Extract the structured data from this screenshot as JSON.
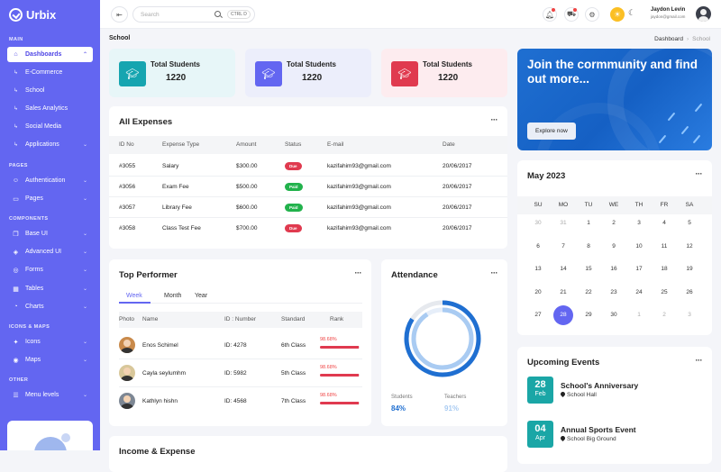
{
  "brand": {
    "name": "Urbix"
  },
  "sidebar": {
    "sections": {
      "main": "MAIN",
      "pages": "PAGES",
      "components": "COMPONENTS",
      "icons_maps": "ICONS & MAPS",
      "other": "OTHER"
    },
    "dashboards": "Dashboards",
    "ecommerce": "E-Commerce",
    "school": "School",
    "sales": "Sales Analytics",
    "social": "Social Media",
    "applications": "Applications",
    "authentication": "Authentication",
    "pages": "Pages",
    "baseui": "Base UI",
    "advancedui": "Advanced UI",
    "forms": "Forms",
    "tables": "Tables",
    "charts": "Charts",
    "icons": "Icons",
    "maps": "Maps",
    "menulevels": "Menu levels"
  },
  "header": {
    "search_placeholder": "Search",
    "shortcut": "CTRL D",
    "user_name": "Jaydon Levin",
    "user_email": "jaydon@gmail.com"
  },
  "page": {
    "title": "School",
    "crumb_parent": "Dashboard",
    "crumb_current": "School"
  },
  "stats": [
    {
      "label": "Total Students",
      "value": "1220",
      "bg": "#e7f6f8",
      "icon_bg": "#16a5b0"
    },
    {
      "label": "Total Students",
      "value": "1220",
      "bg": "#eceefb",
      "icon_bg": "#6366f1"
    },
    {
      "label": "Total Students",
      "value": "1220",
      "bg": "#fdecef",
      "icon_bg": "#e03a4f"
    }
  ],
  "expenses": {
    "title": "All Expenses",
    "columns": [
      "ID No",
      "Expense Type",
      "Amount",
      "Status",
      "E-mail",
      "Date"
    ],
    "rows": [
      {
        "id": "#3055",
        "type": "Salary",
        "amount": "$300.00",
        "status": "Due",
        "email": "kazifahim93@gmail.com",
        "date": "20/06/2017"
      },
      {
        "id": "#3056",
        "type": "Exam Fee",
        "amount": "$500.00",
        "status": "Paid",
        "email": "kazifahim93@gmail.com",
        "date": "20/06/2017"
      },
      {
        "id": "#3057",
        "type": "Library Fee",
        "amount": "$600.00",
        "status": "Paid",
        "email": "kazifahim93@gmail.com",
        "date": "20/06/2017"
      },
      {
        "id": "#3058",
        "type": "Class Test Fee",
        "amount": "$700.00",
        "status": "Due",
        "email": "kazifahim93@gmail.com",
        "date": "20/06/2017"
      }
    ],
    "status_colors": {
      "Due": "#e03a4f",
      "Paid": "#22b24c"
    }
  },
  "performer": {
    "title": "Top Performer",
    "tabs": [
      "Week",
      "Month",
      "Year"
    ],
    "columns": [
      "Photo",
      "Name",
      "ID : Number",
      "Standard",
      "Rank"
    ],
    "rows": [
      {
        "name": "Enos Schimel",
        "id": "ID: 4278",
        "standard": "6th Class",
        "rank": "98.68%",
        "rank_value": 0.9868
      },
      {
        "name": "Cayla seylumhm",
        "id": "ID: 5982",
        "standard": "5th Class",
        "rank": "98.68%",
        "rank_value": 0.9868
      },
      {
        "name": "Kathlyn hishn",
        "id": "ID: 4568",
        "standard": "7th Class",
        "rank": "98.68%",
        "rank_value": 0.9868
      }
    ]
  },
  "attendance": {
    "title": "Attendance",
    "students_label": "Students",
    "students_value": "84%",
    "students_fraction": 0.84,
    "teachers_label": "Teachers",
    "teachers_value": "91%",
    "teachers_fraction": 0.91
  },
  "promo": {
    "title": "Join the cormmunity and find out more...",
    "button": "Explore now"
  },
  "calendar": {
    "month": "May 2023",
    "dow": [
      "SU",
      "MO",
      "TU",
      "WE",
      "TH",
      "FR",
      "SA"
    ],
    "weeks": [
      [
        "30",
        "31",
        "1",
        "2",
        "3",
        "4",
        "5"
      ],
      [
        "6",
        "7",
        "8",
        "9",
        "10",
        "11",
        "12"
      ],
      [
        "13",
        "14",
        "15",
        "16",
        "17",
        "18",
        "19"
      ],
      [
        "20",
        "21",
        "22",
        "23",
        "24",
        "25",
        "26"
      ],
      [
        "27",
        "28",
        "29",
        "30",
        "1",
        "2",
        "3"
      ]
    ],
    "selected": "28"
  },
  "events": {
    "title": "Upcoming Events",
    "items": [
      {
        "day": "28",
        "month": "Feb",
        "name": "School's Anniversary",
        "location": "School Hall"
      },
      {
        "day": "04",
        "month": "Apr",
        "name": "Annual Sports Event",
        "location": "School Big Ground"
      }
    ]
  },
  "income": {
    "title": "Income & Expense"
  }
}
